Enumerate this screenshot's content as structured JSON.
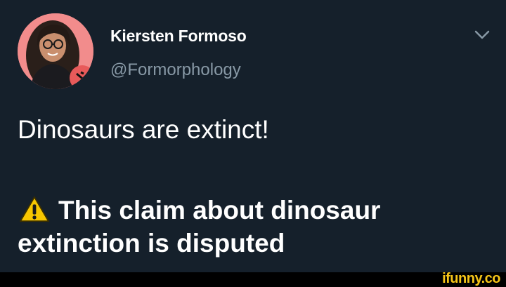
{
  "tweet": {
    "author": {
      "display_name": "Kiersten Formoso",
      "handle": "@Formorphology",
      "avatar_icon": "profile-photo"
    },
    "menu_icon": "chevron-down-icon",
    "text": "Dinosaurs are extinct!",
    "disclaimer": {
      "icon": "warning-icon",
      "text": "This claim about dinosaur extinction is disputed"
    }
  },
  "watermark": {
    "text": "ifunny.co"
  },
  "colors": {
    "background": "#15202b",
    "text_primary": "#ffffff",
    "text_secondary": "#8899a6",
    "warning": "#f7c600",
    "watermark": "#f5c518"
  }
}
